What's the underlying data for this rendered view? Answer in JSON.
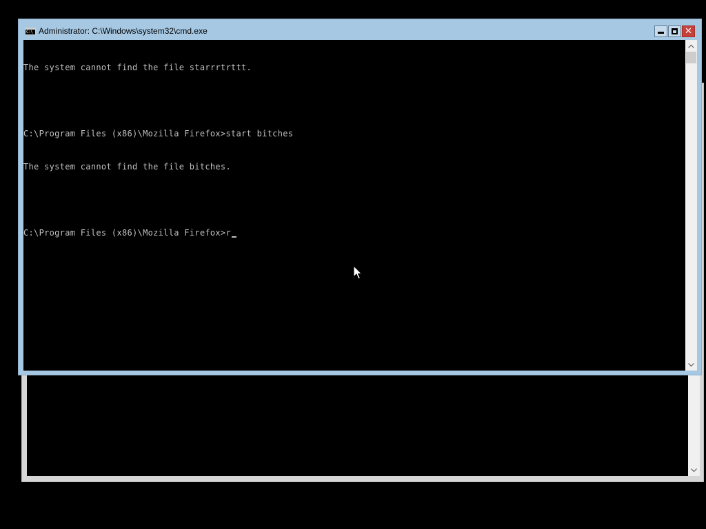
{
  "window": {
    "title": "Administrator: C:\\Windows\\system32\\cmd.exe",
    "icon": "cmd-app-icon",
    "icon_text": "C:\\",
    "buttons": {
      "minimize": "minimize-icon",
      "maximize": "maximize-icon",
      "close": "close-icon",
      "close_color": "#c7413c"
    },
    "frame_color": "#a6c8e3"
  },
  "console": {
    "background": "#000000",
    "foreground": "#c0c0c0",
    "lines": [
      "The system cannot find the file starrrtrttt.",
      "",
      "C:\\Program Files (x86)\\Mozilla Firefox>start bitches",
      "The system cannot find the file bitches.",
      "",
      "C:\\Program Files (x86)\\Mozilla Firefox>r"
    ]
  },
  "scrollbar": {
    "up": "chevron-up-icon",
    "down": "chevron-down-icon"
  },
  "background_window": {
    "scroll_down": "chevron-down-icon"
  },
  "pointer": "mouse-pointer-icon"
}
